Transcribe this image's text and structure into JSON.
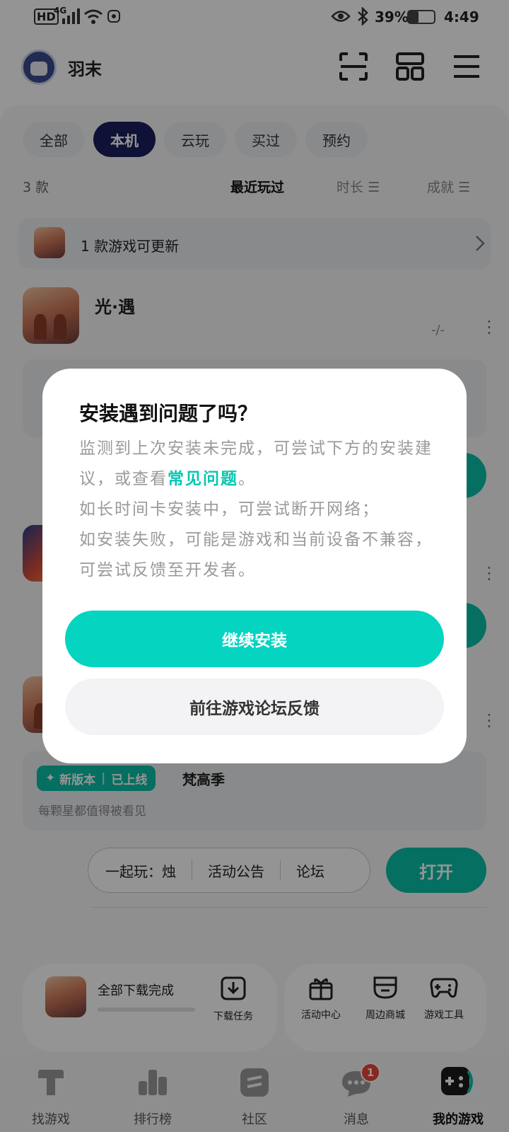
{
  "status_bar": {
    "left_text": "HD",
    "signal": "4G",
    "battery": "39%",
    "time": "4:49"
  },
  "header": {
    "username": "羽末"
  },
  "tabs": [
    {
      "label": "全部"
    },
    {
      "label": "本机"
    },
    {
      "label": "云玩"
    },
    {
      "label": "买过"
    },
    {
      "label": "预约"
    }
  ],
  "sort_bar": {
    "count": "3 款",
    "recent": "最近玩过",
    "duration": "时长",
    "achievement": "成就"
  },
  "update_banner": {
    "text": "1 款游戏可更新"
  },
  "game1": {
    "name": "光·遇",
    "stat": "-/-"
  },
  "game3": {
    "badge_new": "新版本",
    "badge_live": "已上线",
    "season": "梵高季",
    "tagline": "每颗星都值得被看见",
    "links": [
      "一起玩：烛",
      "活动公告",
      "论坛"
    ],
    "open_button": "打开"
  },
  "bottom_tools": {
    "download_status": "全部下载完成",
    "download_task": "下载任务",
    "activity_center": "活动中心",
    "merch_store": "周边商城",
    "game_tools": "游戏工具"
  },
  "bottom_nav": {
    "items": [
      {
        "label": "找游戏"
      },
      {
        "label": "排行榜"
      },
      {
        "label": "社区"
      },
      {
        "label": "消息",
        "badge": "1"
      },
      {
        "label": "我的游戏"
      }
    ]
  },
  "dialog": {
    "title": "安装遇到问题了吗？",
    "body_1": "监测到上次安装未完成，可尝试下方的安装建议，或查看",
    "link": "常见问题",
    "body_2": "。",
    "body_3": "如长时间卡安装中，可尝试断开网络；",
    "body_4": "如安装失败，可能是游戏和当前设备不兼容，可尝试反馈至开发者。",
    "primary_button": "继续安装",
    "secondary_button": "前往游戏论坛反馈"
  },
  "colors": {
    "accent": "#04d4c0",
    "tab_active": "#1a1f5e",
    "open_button": "#0abfa8",
    "badge": "#e8453c"
  }
}
